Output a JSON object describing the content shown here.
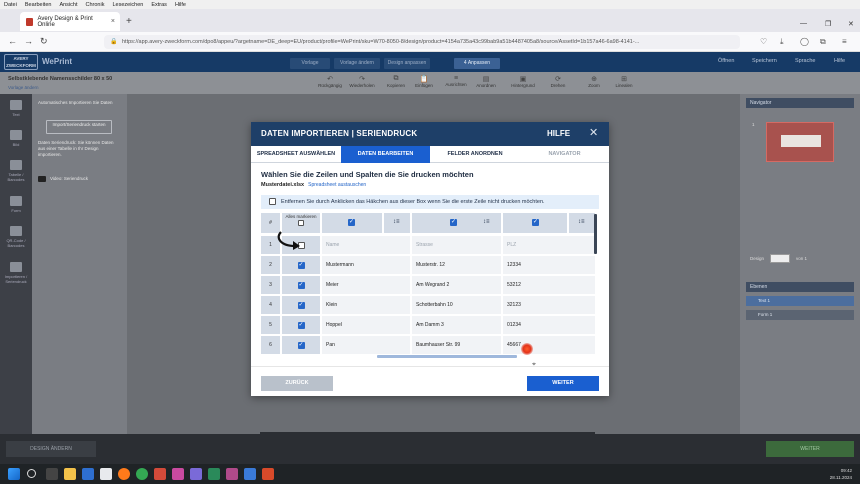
{
  "browser": {
    "menu": [
      "Datei",
      "Bearbeiten",
      "Ansicht",
      "Chronik",
      "Lesezeichen",
      "Extras",
      "Hilfe"
    ],
    "tab_title": "Avery Design & Print Online",
    "url": "https://app.avery-zweckform.com/dpo8/appeu/?argetname=DE_deep=EU/product/profile=WePrint/sku=W70-8050-8/design/product=4154a735a43c99bab9a51b4487405a8/source/AssetId=1b157a46-6a98-4141-..."
  },
  "app": {
    "logo_text": "AVERY ZWECKFORM",
    "brand": "WePrint",
    "steps": [
      "Vorlage",
      "Vorlage ändern",
      "Design anpassen",
      "4 Anpassen"
    ],
    "header_links": [
      "Öffnen",
      "Speichern",
      "Sprache",
      "Hilfe"
    ],
    "project_name": "Selbstklebende Namensschilder 80 x 50",
    "save_link": "Vorlage ändern",
    "tools": [
      "Rückgängig",
      "Wiederholen",
      "Kopieren",
      "Einfügen",
      "Ausrichten",
      "Anordnen",
      "Hintergrund",
      "Drehen",
      "Zoom",
      "Linealen"
    ],
    "rail": [
      "Text",
      "Bild",
      "Tabelle / Barcodes",
      "Form",
      "QR-Code / Barcodes",
      "Importieren / Seriendruck"
    ],
    "left_panel": {
      "text1": "Automatisches Importieren Sie Daten",
      "import_button": "Import/Seriendruck starten",
      "text2": "Daten Seriendruck: Sie können Daten aus einer Tabelle in Ihr Design importieren.",
      "video_link": "Video: Seriendruck"
    },
    "right_panel": {
      "nav_head": "Navigator",
      "page_label": "1",
      "design_label": "Design",
      "page_of": "von 1",
      "layers_head": "Ebenen",
      "layers": [
        "Text 1",
        "Form 1"
      ]
    },
    "bottom": {
      "design_button": "DESIGN ÄNDERN",
      "weiter_button": "WEITER"
    }
  },
  "modal": {
    "title": "DATEN IMPORTIEREN | SERIENDRUCK",
    "help": "HILFE",
    "steps": [
      {
        "label": "SPREADSHEET AUSWÄHLEN",
        "state": "done"
      },
      {
        "label": "DATEN BEARBEITEN",
        "state": "active"
      },
      {
        "label": "FELDER ANORDNEN",
        "state": "todo"
      },
      {
        "label": "NAVIGATOR",
        "state": "dim"
      }
    ],
    "heading": "Wählen Sie die Zeilen und Spalten die Sie drucken möchten",
    "file_name": "Musterdatei.xlsx",
    "replace_link": "Spreadsheet austauschen",
    "notice": "Entfernen Sie durch Anklicken das Häkchen aus dieser Box wenn Sie die erste Zeile nicht drucken möchten.",
    "table": {
      "hash_label": "#",
      "select_all_label": "Alles markieren",
      "rows": [
        {
          "n": "1",
          "checked": false,
          "cells": [
            "Name",
            "Strasse",
            "PLZ"
          ],
          "placeholder": true
        },
        {
          "n": "2",
          "checked": true,
          "cells": [
            "Mustermann",
            "Musterstr. 12",
            "12334"
          ]
        },
        {
          "n": "3",
          "checked": true,
          "cells": [
            "Meier",
            "Am Wegrand 2",
            "53212"
          ]
        },
        {
          "n": "4",
          "checked": true,
          "cells": [
            "Klein",
            "Schotterbahn 10",
            "32123"
          ]
        },
        {
          "n": "5",
          "checked": true,
          "cells": [
            "Hoppel",
            "Am Damm 3",
            "01234"
          ]
        },
        {
          "n": "6",
          "checked": true,
          "cells": [
            "Pan",
            "Baumhauser Str. 99",
            "45667"
          ]
        }
      ]
    },
    "back_button": "ZURÜCK",
    "next_button": "WEITER"
  },
  "taskbar": {
    "time": "09:42",
    "date": "28.11.2024"
  }
}
